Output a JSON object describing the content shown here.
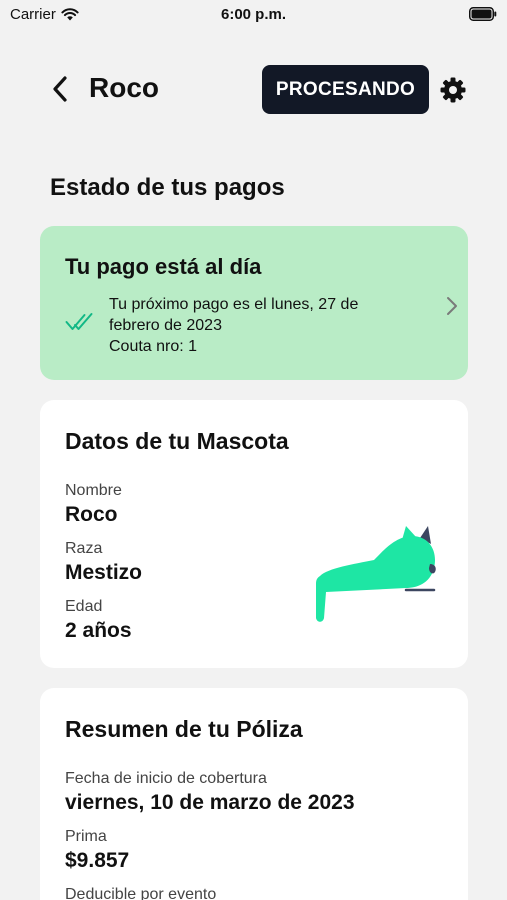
{
  "status_bar": {
    "carrier": "Carrier",
    "time": "6:00 p.m."
  },
  "nav": {
    "title": "Roco",
    "status_button": "PROCESANDO"
  },
  "section_title": "Estado de tus pagos",
  "payment": {
    "title": "Tu pago está al día",
    "line1": "Tu próximo pago es el lunes, 27 de",
    "line2": "febrero de 2023",
    "line3": "Couta nro: 1",
    "accent_color": "#b9ecc6"
  },
  "pet": {
    "title": "Datos de tu Mascota",
    "fields": [
      {
        "label": "Nombre",
        "value": "Roco"
      },
      {
        "label": "Raza",
        "value": "Mestizo"
      },
      {
        "label": "Edad",
        "value": "2 años"
      }
    ],
    "illustration_color": "#1ee6a4"
  },
  "policy": {
    "title": "Resumen de tu Póliza",
    "fields": [
      {
        "label": "Fecha de inicio de cobertura",
        "value": "viernes, 10 de marzo de 2023"
      },
      {
        "label": "Prima",
        "value": "$9.857"
      },
      {
        "label": "Deducible por evento"
      }
    ]
  },
  "icons": [
    "wifi-icon",
    "battery-icon",
    "back-chevron-icon",
    "gear-icon",
    "double-check-icon",
    "chevron-right-icon",
    "cat-illustration"
  ]
}
